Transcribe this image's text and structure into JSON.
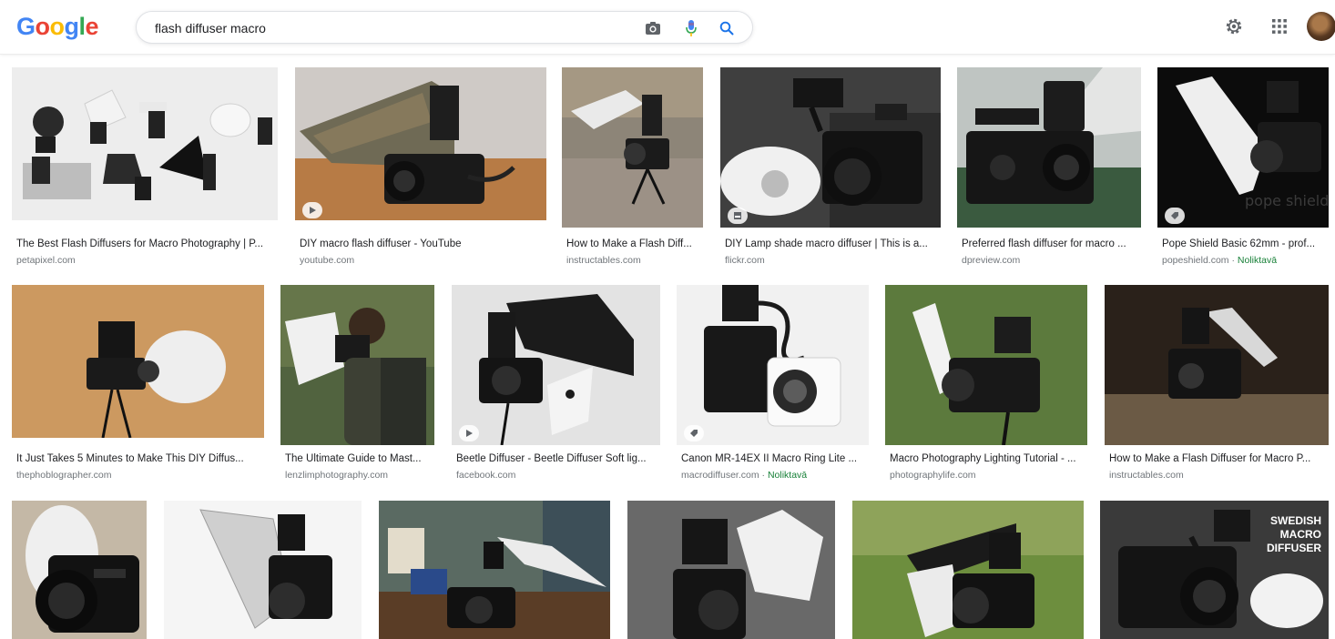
{
  "header": {
    "logo": [
      "G",
      "o",
      "o",
      "g",
      "l",
      "e"
    ],
    "logo_colors": [
      "#4285F4",
      "#EA4335",
      "#FBBC05",
      "#4285F4",
      "#34A853",
      "#EA4335"
    ],
    "search": {
      "value": "flash diffuser macro"
    },
    "icons": {
      "camera": "camera-icon",
      "mic": "microphone-icon",
      "search": "search-icon",
      "settings": "gear-icon",
      "apps": "apps-grid-icon",
      "avatar": "avatar"
    }
  },
  "colors": {
    "accent_blue": "#1a73e8",
    "mic_blue": "#4285F4",
    "mic_red": "#EA4335",
    "source_gray": "#70757a",
    "stock_green": "#188038"
  },
  "results": [
    {
      "title": "The Best Flash Diffusers for Macro Photography | P...",
      "source": "petapixel.com",
      "extra": ""
    },
    {
      "title": "DIY macro flash diffuser - YouTube",
      "source": "youtube.com",
      "extra": "",
      "badge": "play-icon"
    },
    {
      "title": "How to Make a Flash Diff...",
      "source": "instructables.com",
      "extra": ""
    },
    {
      "title": "DIY Lamp shade macro diffuser | This is a...",
      "source": "flickr.com",
      "extra": "",
      "badge": "image-icon"
    },
    {
      "title": "Preferred flash diffuser for macro ...",
      "source": "dpreview.com",
      "extra": ""
    },
    {
      "title": "Pope Shield Basic 62mm - prof...",
      "source": "popeshield.com",
      "extra": "Noliktavā",
      "badge": "tag-icon",
      "watermark": "pope shield"
    },
    {
      "title": "It Just Takes 5 Minutes to Make This DIY Diffus...",
      "source": "thephoblographer.com",
      "extra": ""
    },
    {
      "title": "The Ultimate Guide to Mast...",
      "source": "lenzlimphotography.com",
      "extra": ""
    },
    {
      "title": "Beetle Diffuser - Beetle Diffuser Soft lig...",
      "source": "facebook.com",
      "extra": "",
      "badge": "play-icon"
    },
    {
      "title": "Canon MR-14EX II Macro Ring Lite ...",
      "source": "macrodiffuser.com",
      "extra": "Noliktavā",
      "badge": "tag-icon"
    },
    {
      "title": "Macro Photography Lighting Tutorial - ...",
      "source": "photographylife.com",
      "extra": ""
    },
    {
      "title": "How to Make a Flash Diffuser for Macro P...",
      "source": "instructables.com",
      "extra": ""
    },
    {
      "title": "",
      "source": "",
      "extra": ""
    },
    {
      "title": "",
      "source": "",
      "extra": ""
    },
    {
      "title": "",
      "source": "",
      "extra": ""
    },
    {
      "title": "",
      "source": "",
      "extra": ""
    },
    {
      "title": "",
      "source": "",
      "extra": ""
    },
    {
      "title": "",
      "source": "",
      "extra": "",
      "overlay": [
        "SWEDISH",
        "MACRO",
        "DIFFUSER"
      ]
    }
  ],
  "separator": " · "
}
